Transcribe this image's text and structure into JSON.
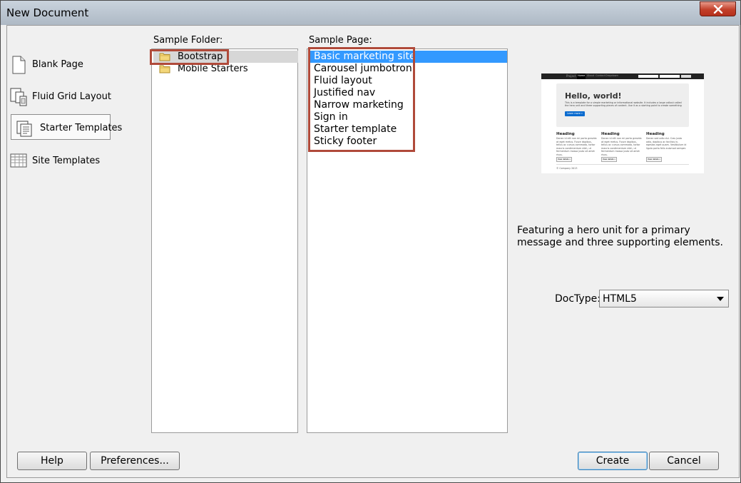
{
  "window": {
    "title": "New Document"
  },
  "categories": [
    {
      "label": "Blank Page",
      "icon": "blank-page-icon"
    },
    {
      "label": "Fluid Grid Layout",
      "icon": "fluid-grid-icon"
    },
    {
      "label": "Starter Templates",
      "icon": "starter-templates-icon",
      "selected": true
    },
    {
      "label": "Site Templates",
      "icon": "site-templates-icon"
    }
  ],
  "sample_folder": {
    "label": "Sample Folder:",
    "items": [
      {
        "label": "Bootstrap",
        "selected": true
      },
      {
        "label": "Mobile Starters"
      }
    ]
  },
  "sample_page": {
    "label": "Sample Page:",
    "items": [
      {
        "label": "Basic marketing site",
        "selected": true
      },
      {
        "label": "Carousel jumbotron"
      },
      {
        "label": "Fluid layout"
      },
      {
        "label": "Justified nav"
      },
      {
        "label": "Narrow marketing"
      },
      {
        "label": "Sign in"
      },
      {
        "label": "Starter template"
      },
      {
        "label": "Sticky footer"
      }
    ]
  },
  "preview": {
    "brand": "Project name",
    "nav": [
      "Home",
      "About",
      "Contact",
      "Dropdown"
    ],
    "hero_title": "Hello, world!",
    "hero_text": "This is a template for a simple marketing or informational website. It includes a large callout called the hero unit and three supporting pieces of content. Use it as a starting point to create something more unique.",
    "hero_button": "Learn more »",
    "columns": [
      {
        "heading": "Heading",
        "text": "Donec id elit non mi porta gravida at eget metus. Fusce dapibus, tellus ac cursus commodo, tortor mauris condimentum nibh, ut fermentum massa justo sit amet risus.",
        "button": "View details »"
      },
      {
        "heading": "Heading",
        "text": "Donec id elit non mi porta gravida at eget metus. Fusce dapibus, tellus ac cursus commodo, tortor mauris condimentum nibh, ut fermentum massa justo sit amet risus.",
        "button": "View details »"
      },
      {
        "heading": "Heading",
        "text": "Donec sed odio dui. Cras justo odio, dapibus ac facilisis in, egestas eget quam. Vestibulum id ligula porta felis euismod semper.",
        "button": "View details »"
      }
    ],
    "footer": "© Company 2013"
  },
  "description": "Featuring a hero unit for a primary message and three supporting elements.",
  "doctype": {
    "label": "DocType:",
    "value": "HTML5"
  },
  "buttons": {
    "help": "Help",
    "preferences": "Preferences...",
    "create": "Create",
    "cancel": "Cancel"
  },
  "colors": {
    "selection": "#3399ff",
    "highlight_box": "#b04a3a",
    "close_button": "#c2402a"
  }
}
